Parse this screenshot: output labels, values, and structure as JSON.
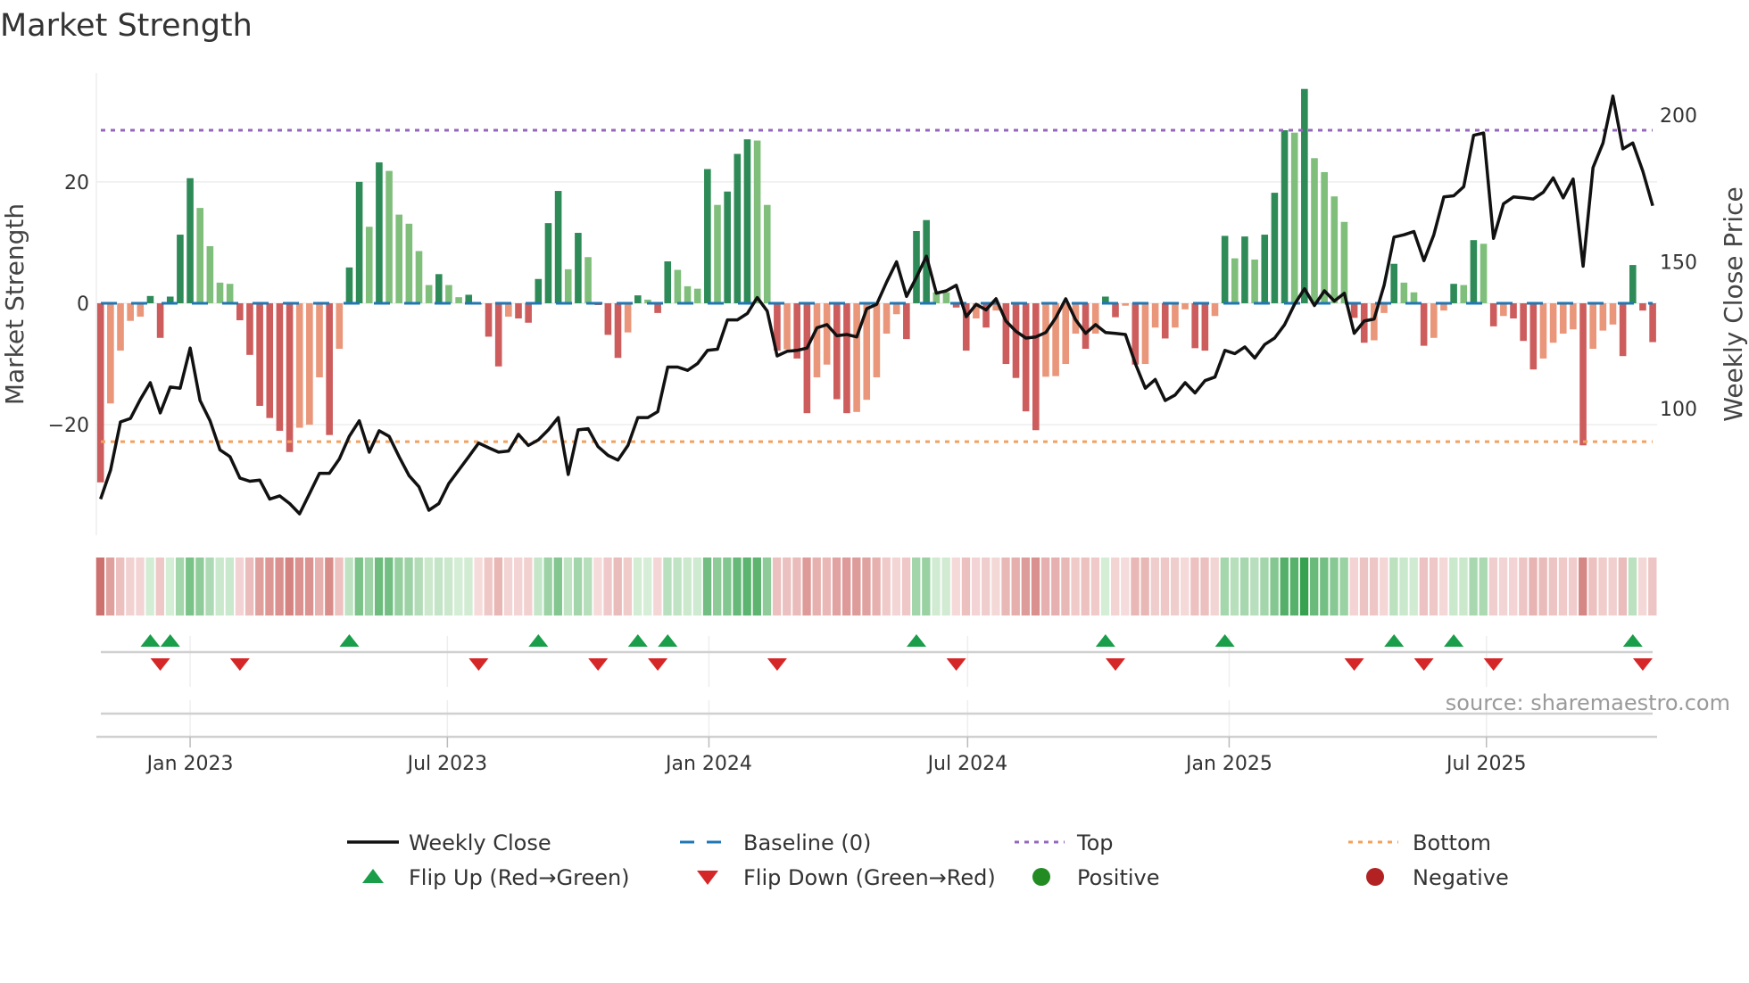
{
  "title": "Market Strength",
  "source": "source: sharemaestro.com",
  "legend": {
    "weekly_close": "Weekly Close",
    "baseline": "Baseline (0)",
    "top": "Top",
    "bottom": "Bottom",
    "flip_up": "Flip Up (Red→Green)",
    "flip_down": "Flip Down (Green→Red)",
    "positive": "Positive",
    "negative": "Negative"
  },
  "colors": {
    "bar_up_strong": "#2e8b57",
    "bar_up_weak": "#7fbf7b",
    "bar_down_strong": "#cd5c5c",
    "bar_down_weak": "#e9967a",
    "price_line": "#111111",
    "baseline": "#1f77b4",
    "top": "#9467bd",
    "bottom": "#f4a15d",
    "flip_up": "#1a9e4a",
    "flip_down": "#d62728",
    "positive": "#228b22",
    "negative": "#b22222"
  },
  "chart_data": {
    "type": "bar",
    "title": "Market Strength",
    "xlabel": "",
    "ylabel": "Market Strength",
    "y2label": "Weekly Close Price",
    "x_start_week": "2022-10-30",
    "x_frequency": "weekly",
    "ylim": [
      -38.2,
      37.9
    ],
    "y2lim": [
      56.8,
      214.3
    ],
    "yticks": [
      {
        "value": 20,
        "label": "20"
      },
      {
        "value": 0,
        "label": "0"
      },
      {
        "value": -20,
        "label": "−20"
      }
    ],
    "y2ticks": [
      {
        "value": 200,
        "label": "200"
      },
      {
        "value": 150,
        "label": "150"
      },
      {
        "value": 100,
        "label": "100"
      }
    ],
    "xticks": [
      {
        "date": "2023-01-01",
        "label": "Jan 2023"
      },
      {
        "date": "2023-07-01",
        "label": "Jul 2023"
      },
      {
        "date": "2024-01-01",
        "label": "Jan 2024"
      },
      {
        "date": "2024-07-01",
        "label": "Jul 2024"
      },
      {
        "date": "2025-01-01",
        "label": "Jan 2025"
      },
      {
        "date": "2025-07-01",
        "label": "Jul 2025"
      }
    ],
    "reference_lines": {
      "baseline": 0,
      "top": 28.5,
      "bottom": -22.8
    },
    "grid": true,
    "legend_position": "bottom",
    "series": [
      {
        "name": "Market Strength",
        "type": "bar",
        "axis": "left",
        "values": [
          -29.5,
          -16.5,
          -7.8,
          -2.9,
          -2.2,
          1.2,
          -5.7,
          1.1,
          11.3,
          20.6,
          15.7,
          9.4,
          3.4,
          3.2,
          -2.8,
          -8.5,
          -16.9,
          -18.9,
          -21.0,
          -24.5,
          -20.5,
          -20.0,
          -12.2,
          -21.7,
          -7.5,
          5.9,
          20.0,
          12.6,
          23.2,
          21.8,
          14.6,
          13.1,
          8.6,
          3.0,
          4.8,
          3.0,
          1.0,
          1.4,
          -0.2,
          -5.5,
          -10.4,
          -2.2,
          -2.5,
          -3.2,
          4.0,
          13.2,
          18.5,
          5.6,
          11.6,
          7.6,
          -0.3,
          -5.2,
          -9.0,
          -4.8,
          1.3,
          0.6,
          -1.6,
          6.9,
          5.5,
          2.8,
          2.4,
          22.1,
          16.2,
          18.4,
          24.6,
          27.0,
          26.8,
          16.2,
          -7.8,
          -7.6,
          -9.1,
          -18.1,
          -12.2,
          -10.1,
          -15.8,
          -18.1,
          -17.9,
          -15.9,
          -12.2,
          -5.0,
          -1.8,
          -5.9,
          11.9,
          13.7,
          1.8,
          1.8,
          -0.7,
          -7.8,
          -2.5,
          -4.0,
          -1.2,
          -10.0,
          -12.3,
          -17.8,
          -20.9,
          -12.1,
          -12.0,
          -10.0,
          -5.0,
          -7.5,
          -5.0,
          1.1,
          -2.3,
          -0.4,
          -10.1,
          -10.0,
          -4.0,
          -5.8,
          -4.0,
          -1.0,
          -7.4,
          -7.8,
          -2.1,
          11.1,
          7.4,
          11.0,
          7.2,
          11.3,
          18.2,
          28.5,
          28.1,
          35.3,
          23.9,
          21.6,
          17.6,
          13.4,
          -2.4,
          -6.5,
          -6.1,
          -1.6,
          6.5,
          3.4,
          1.8,
          -7.0,
          -5.7,
          -1.2,
          3.2,
          3.0,
          10.4,
          9.8,
          -3.8,
          -2.1,
          -2.5,
          -6.2,
          -10.9,
          -9.1,
          -6.5,
          -5.0,
          -4.3,
          -23.4,
          -7.5,
          -4.5,
          -3.5,
          -8.7,
          6.3,
          -1.2,
          -6.4
        ]
      },
      {
        "name": "Weekly Close",
        "type": "line",
        "axis": "right",
        "values": [
          69.1,
          79.0,
          95.4,
          96.6,
          103.1,
          108.8,
          98.5,
          107.3,
          106.9,
          120.6,
          102.7,
          95.8,
          85.9,
          83.6,
          76.3,
          75.2,
          75.6,
          69.1,
          70.2,
          67.6,
          64.1,
          71.0,
          77.9,
          77.9,
          82.8,
          90.5,
          95.8,
          85.1,
          92.4,
          90.5,
          83.6,
          77.1,
          73.3,
          65.3,
          67.6,
          74.4,
          79.0,
          83.6,
          88.2,
          86.6,
          85.1,
          85.5,
          91.2,
          87.4,
          89.3,
          92.7,
          96.9,
          77.5,
          92.7,
          93.1,
          87.0,
          84.0,
          82.4,
          87.4,
          96.9,
          96.9,
          98.9,
          114.1,
          114.1,
          113.0,
          115.3,
          119.8,
          120.2,
          130.2,
          130.2,
          132.4,
          137.8,
          133.2,
          117.9,
          119.5,
          119.8,
          120.6,
          127.5,
          128.6,
          124.8,
          125.2,
          124.4,
          134.0,
          135.5,
          143.1,
          150.0,
          138.2,
          144.7,
          151.9,
          139.3,
          140.1,
          142.0,
          131.3,
          135.5,
          133.6,
          137.4,
          129.8,
          126.3,
          124.0,
          124.4,
          125.9,
          130.9,
          137.4,
          130.2,
          125.6,
          128.6,
          125.9,
          125.6,
          125.2,
          115.3,
          106.9,
          109.9,
          102.7,
          104.6,
          108.8,
          105.3,
          109.5,
          110.7,
          119.8,
          118.7,
          121.0,
          117.2,
          121.8,
          124.0,
          128.6,
          135.5,
          140.8,
          135.1,
          140.1,
          136.6,
          139.3,
          125.6,
          129.8,
          130.5,
          142.0,
          158.4,
          159.2,
          160.3,
          150.4,
          159.2,
          172.1,
          172.5,
          175.6,
          193.1,
          193.9,
          158.0,
          169.8,
          172.1,
          171.8,
          171.4,
          173.7,
          178.6,
          171.8,
          178.2,
          148.5,
          182.1,
          190.5,
          206.5,
          188.5,
          190.5,
          180.9,
          169.1
        ]
      }
    ]
  }
}
